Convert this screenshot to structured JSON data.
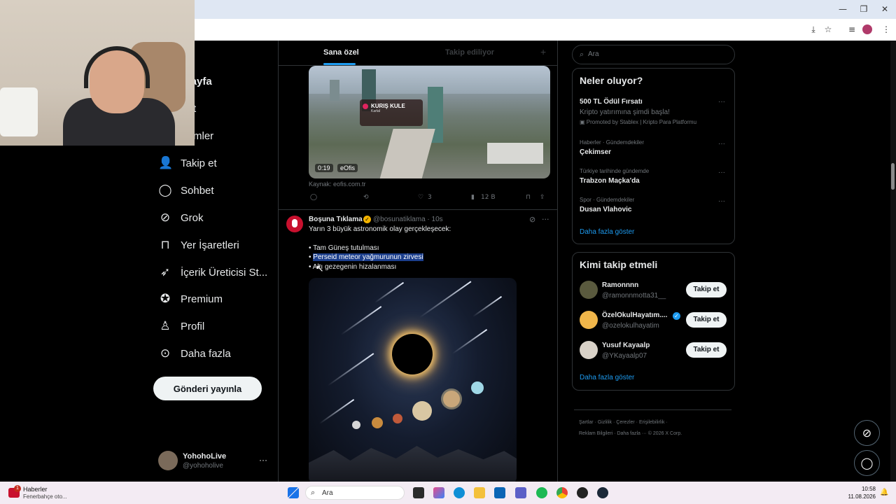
{
  "browser": {
    "window_buttons": {
      "minimize": "—",
      "restore": "❐",
      "close": "✕"
    },
    "toolbar_icons": [
      "install-icon",
      "star-icon",
      "tab-search-icon",
      "profile-icon",
      "menu-icon"
    ]
  },
  "nav": {
    "items": [
      {
        "label": "asayfa",
        "icon": "home-icon"
      },
      {
        "label": "sfet",
        "icon": "explore-icon"
      },
      {
        "label": "dirimler",
        "icon": "bell-icon"
      },
      {
        "label": "Takip et",
        "icon": "follow-icon"
      },
      {
        "label": "Sohbet",
        "icon": "chat-icon"
      },
      {
        "label": "Grok",
        "icon": "grok-icon"
      },
      {
        "label": "Yer İşaretleri",
        "icon": "bookmark-icon"
      },
      {
        "label": "İçerik Üreticisi St...",
        "icon": "rocket-icon"
      },
      {
        "label": "Premium",
        "icon": "premium-icon"
      },
      {
        "label": "Profil",
        "icon": "person-icon"
      },
      {
        "label": "Daha fazla",
        "icon": "more-circle-icon"
      }
    ],
    "post_button": "Gönderi yayınla",
    "account": {
      "name": "YohohoLive",
      "handle": "@yohoholive",
      "more": "···"
    }
  },
  "feed": {
    "tabs": {
      "active": "Sana özel",
      "inactive": "Takip ediliyor",
      "plus": "+"
    },
    "video_post": {
      "overlay_title": "KURIŞ KULE",
      "overlay_sub": "Kartal",
      "duration": "0:19",
      "source_badge": "eOfis",
      "source_line": "Kaynak: eofis.com.tr",
      "likes": "3",
      "views": "12 B"
    },
    "tweet": {
      "name": "Boşuna Tıklama",
      "handle": "@bosunatiklama · 10s",
      "lines": [
        "Yarın 3 büyük astronomik olay gerçekleşecek:",
        "• Tam Güneş tutulması",
        "Perseid meteor yağmurunun zirvesi",
        "• Altı gezegenin hizalanması"
      ],
      "bullet": "• "
    }
  },
  "sidebar": {
    "search_placeholder": "Ara",
    "trends": {
      "title": "Neler oluyor?",
      "items": [
        {
          "meta": "",
          "title": "500 TL Ödül Fırsatı",
          "sub": "Kripto yatırımına şimdi başla!",
          "promo": "Promoted by Stablex | Kripto Para Platformu"
        },
        {
          "meta": "Haberler · Gündemdekiler",
          "title": "Çekimser"
        },
        {
          "meta": "Türkiye tarihinde gündemde",
          "title": "Trabzon Maçka'da"
        },
        {
          "meta": "Spor · Gündemdekiler",
          "title": "Dusan Vlahovic"
        }
      ],
      "more": "···",
      "show_more": "Daha fazla göster"
    },
    "who_to_follow": {
      "title": "Kimi takip etmeli",
      "users": [
        {
          "name": "Ramonnnn",
          "handle": "@ramonnmotta31__",
          "button": "Takip et"
        },
        {
          "name": "ÖzelOkulHayatım....",
          "handle": "@ozelokulhayatim",
          "button": "Takip et"
        },
        {
          "name": "Yusuf Kayaalp",
          "handle": "@YKayaalp07",
          "button": "Takip et"
        }
      ],
      "show_more": "Daha fazla göster"
    },
    "footer": {
      "line1": "Şartlar  ·  Gizlilik  ·  Çerezler  ·  Erişilebilirlik  ·",
      "line2": "Reklam Bilgileri  ·  Daha fazla ···  © 2026 X Corp."
    }
  },
  "taskbar": {
    "news_title": "Haberler",
    "news_sub": "Fenerbahçe oto...",
    "news_badge": "1",
    "search_placeholder": "Ara",
    "time": "10:58",
    "date": "11.08.2026"
  },
  "colors": {
    "accent": "#1d9bf0",
    "background": "#000000",
    "selection": "#1b3e8c"
  }
}
